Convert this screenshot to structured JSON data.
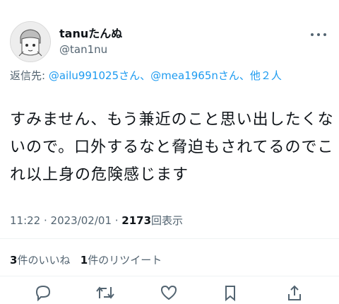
{
  "author": {
    "display_name": "tanuたんぬ",
    "handle": "@tan1nu"
  },
  "reply_to": {
    "prefix": "返信先:",
    "user1": "@ailu991025",
    "sep1": "さん、",
    "user2": "@mea1965n",
    "sep2": "さん、",
    "others": "他２人"
  },
  "tweet": {
    "text": "すみません、もう兼近のこと思い出したくないので。口外するなと脅迫もされてるのでこれ以上身の危険感じます",
    "time": "11:22 · 2023/02/01 · ",
    "views_count": "2173",
    "views_label": "回表示"
  },
  "stats": {
    "quotes_count": "3",
    "quotes_label": "件のいいね",
    "retweets_count": "1",
    "retweets_label": "件のリツイート"
  },
  "icons": [
    "avatar-illustration",
    "more-dots-icon",
    "reply-icon",
    "retweet-icon",
    "like-icon",
    "bookmark-icon",
    "share-icon"
  ],
  "colors": {
    "link": "#1d9bf0",
    "muted": "#536471",
    "text": "#0f1419"
  }
}
